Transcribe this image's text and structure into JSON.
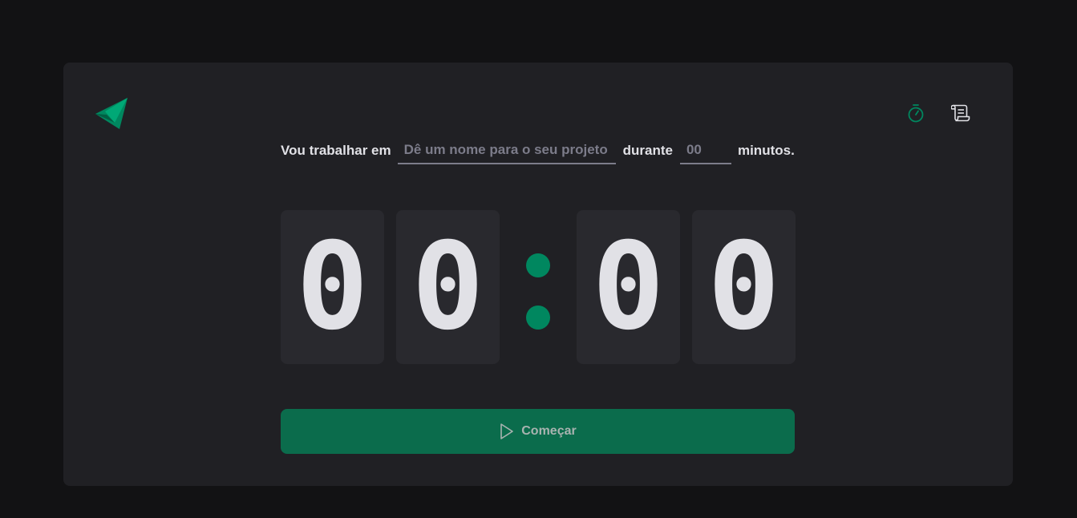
{
  "form": {
    "label_prefix": "Vou trabalhar em",
    "project_placeholder": "Dê um nome para o seu projeto",
    "project_value": "",
    "label_middle": "durante",
    "minutes_placeholder": "00",
    "minutes_value": "",
    "label_suffix": "minutos."
  },
  "countdown": {
    "minutes_tens": "0",
    "minutes_units": "0",
    "separator": ":",
    "seconds_tens": "0",
    "seconds_units": "0"
  },
  "start_button": {
    "label": "Começar",
    "icon": "play-icon"
  },
  "nav": {
    "items": [
      {
        "name": "timer",
        "icon": "timer-icon",
        "active": true
      },
      {
        "name": "history",
        "icon": "scroll-icon",
        "active": false
      }
    ]
  },
  "colors": {
    "background": "#121214",
    "card": "#202024",
    "digit_box": "#29292e",
    "accent": "#00875f",
    "button": "#0b6c4c",
    "text": "#e1e1e6",
    "placeholder": "#7c7c8a"
  }
}
